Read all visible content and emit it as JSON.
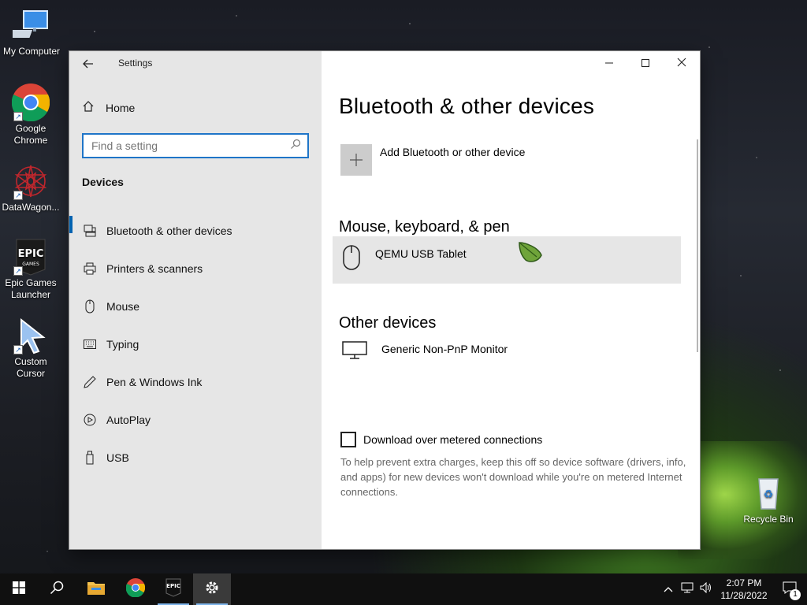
{
  "desktop": {
    "icons": [
      {
        "label": "My Computer"
      },
      {
        "label": "Google Chrome"
      },
      {
        "label": "DataWagon..."
      },
      {
        "label": "Epic Games Launcher"
      },
      {
        "label": "Custom Cursor"
      },
      {
        "label": "Recycle Bin"
      }
    ]
  },
  "window": {
    "title": "Settings",
    "back_icon": "back-arrow-icon"
  },
  "sidebar": {
    "home_label": "Home",
    "search_placeholder": "Find a setting",
    "section_label": "Devices",
    "items": [
      {
        "label": "Bluetooth & other devices",
        "icon": "bluetooth-devices-icon",
        "active": true
      },
      {
        "label": "Printers & scanners",
        "icon": "printer-icon"
      },
      {
        "label": "Mouse",
        "icon": "mouse-icon"
      },
      {
        "label": "Typing",
        "icon": "keyboard-icon"
      },
      {
        "label": "Pen & Windows Ink",
        "icon": "pen-icon"
      },
      {
        "label": "AutoPlay",
        "icon": "autoplay-icon"
      },
      {
        "label": "USB",
        "icon": "usb-icon"
      }
    ]
  },
  "content": {
    "title": "Bluetooth & other devices",
    "add_device_label": "Add Bluetooth or other device",
    "groups": [
      {
        "title": "Mouse, keyboard, & pen",
        "devices": [
          {
            "name": "QEMU USB Tablet",
            "icon": "mouse-icon"
          }
        ]
      },
      {
        "title": "Other devices",
        "devices": [
          {
            "name": "Generic Non-PnP Monitor",
            "icon": "monitor-icon"
          }
        ]
      }
    ],
    "metered_label": "Download over metered connections",
    "metered_checked": false,
    "help_text": "To help prevent extra charges, keep this off so device software (drivers, info, and apps) for new devices won't download while you're on metered Internet connections."
  },
  "taskbar": {
    "time": "2:07 PM",
    "date": "11/28/2022",
    "notification_count": "1"
  },
  "colors": {
    "accent": "#0063b1",
    "search_border": "#1f75c8",
    "sidebar_bg": "#e6e6e6"
  }
}
